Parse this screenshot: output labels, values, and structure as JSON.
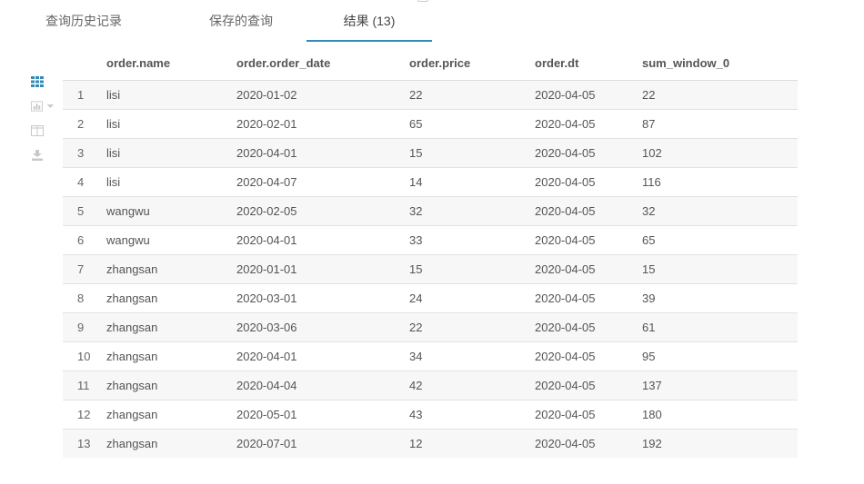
{
  "tabs": {
    "history": "查询历史记录",
    "saved": "保存的查询",
    "results": "结果 (13)"
  },
  "toolbar": {
    "icons": [
      "grid-icon",
      "chart-icon",
      "columns-icon",
      "download-icon"
    ],
    "accent_color": "#338bb8"
  },
  "table": {
    "columns": [
      "",
      "order.name",
      "order.order_date",
      "order.price",
      "order.dt",
      "sum_window_0"
    ],
    "rows": [
      [
        "1",
        "lisi",
        "2020-01-02",
        "22",
        "2020-04-05",
        "22"
      ],
      [
        "2",
        "lisi",
        "2020-02-01",
        "65",
        "2020-04-05",
        "87"
      ],
      [
        "3",
        "lisi",
        "2020-04-01",
        "15",
        "2020-04-05",
        "102"
      ],
      [
        "4",
        "lisi",
        "2020-04-07",
        "14",
        "2020-04-05",
        "116"
      ],
      [
        "5",
        "wangwu",
        "2020-02-05",
        "32",
        "2020-04-05",
        "32"
      ],
      [
        "6",
        "wangwu",
        "2020-04-01",
        "33",
        "2020-04-05",
        "65"
      ],
      [
        "7",
        "zhangsan",
        "2020-01-01",
        "15",
        "2020-04-05",
        "15"
      ],
      [
        "8",
        "zhangsan",
        "2020-03-01",
        "24",
        "2020-04-05",
        "39"
      ],
      [
        "9",
        "zhangsan",
        "2020-03-06",
        "22",
        "2020-04-05",
        "61"
      ],
      [
        "10",
        "zhangsan",
        "2020-04-01",
        "34",
        "2020-04-05",
        "95"
      ],
      [
        "11",
        "zhangsan",
        "2020-04-04",
        "42",
        "2020-04-05",
        "137"
      ],
      [
        "12",
        "zhangsan",
        "2020-05-01",
        "43",
        "2020-04-05",
        "180"
      ],
      [
        "13",
        "zhangsan",
        "2020-07-01",
        "12",
        "2020-04-05",
        "192"
      ]
    ]
  }
}
